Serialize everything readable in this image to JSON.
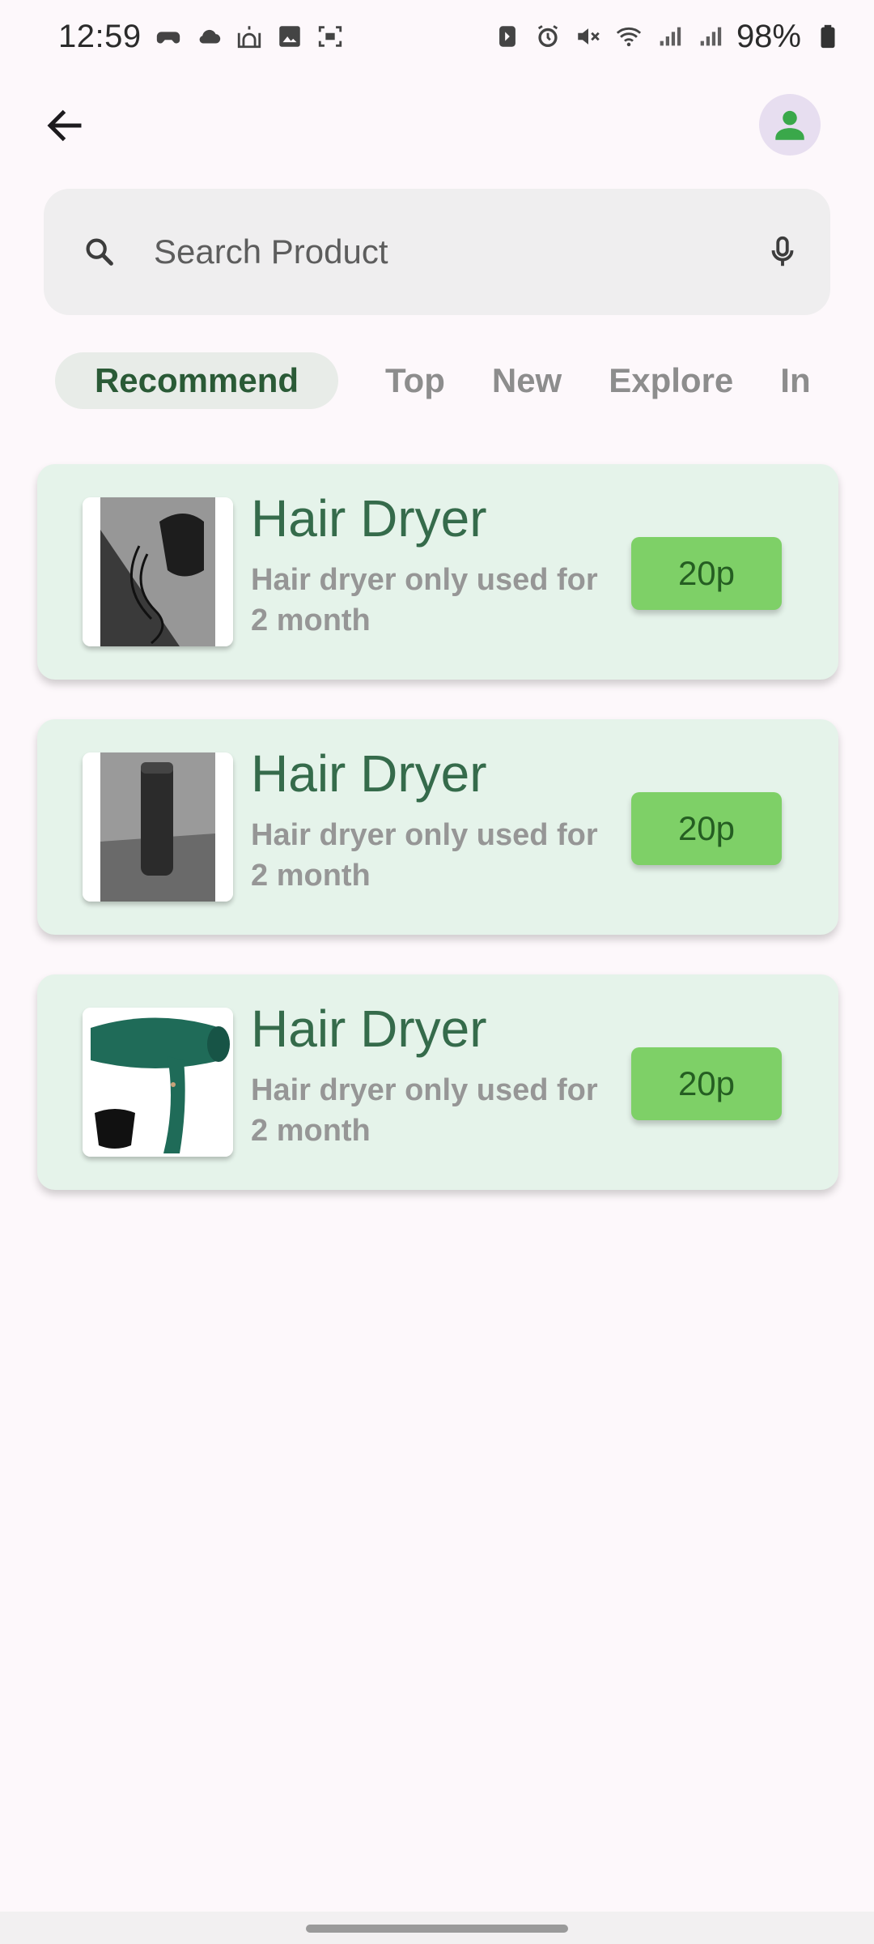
{
  "status_bar": {
    "time": "12:59",
    "battery": "98%",
    "left_icons": [
      "game-controller-icon",
      "cloud-icon",
      "mosque-icon",
      "image-icon",
      "screenshot-icon"
    ],
    "right_icons": [
      "nfc-icon",
      "alarm-icon",
      "mute-icon",
      "wifi-icon",
      "signal-icon",
      "signal-icon",
      "battery-icon"
    ]
  },
  "app_bar": {
    "back_icon": "arrow-left-icon",
    "avatar_icon": "person-icon"
  },
  "search": {
    "placeholder": "Search Product"
  },
  "tabs": [
    {
      "label": "Recommend",
      "active": true
    },
    {
      "label": "Top",
      "active": false
    },
    {
      "label": "New",
      "active": false
    },
    {
      "label": "Explore",
      "active": false
    },
    {
      "label": "In",
      "active": false
    }
  ],
  "products": [
    {
      "title": "Hair Dryer",
      "description": "Hair dryer only used for 2 month",
      "price": "20p",
      "image": "hair-dryer-photo-black"
    },
    {
      "title": "Hair Dryer",
      "description": "Hair dryer only used for 2 month",
      "price": "20p",
      "image": "thermos-photo"
    },
    {
      "title": "Hair Dryer",
      "description": "Hair dryer only used for 2 month",
      "price": "20p",
      "image": "hair-dryer-photo-green"
    }
  ],
  "colors": {
    "background": "#fdf8fb",
    "card": "#e5f3ea",
    "title": "#356b4b",
    "price_button": "#7ed067",
    "price_text": "#255e22",
    "active_tab_text": "#2a5a36",
    "avatar_bg": "#e7def0",
    "avatar_icon": "#3aa84a"
  }
}
